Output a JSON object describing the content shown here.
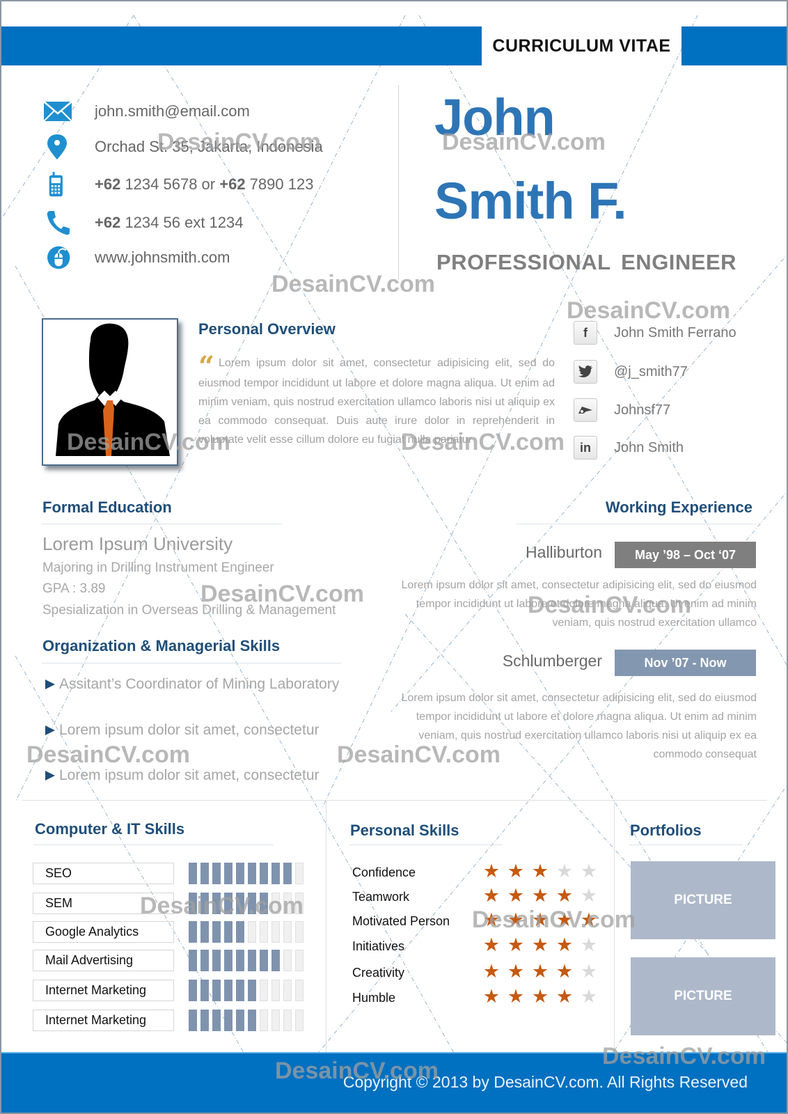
{
  "header": {
    "title": "CURRICULUM VITAE",
    "accent_color": "#0070c0"
  },
  "contact": {
    "email": "john.smith@email.com",
    "address": "Orchad St. 35, Jakarta, Indonesia",
    "mobile_prefix1": "+62",
    "mobile_number1": " 1234 5678 or ",
    "mobile_prefix2": "+62",
    "mobile_number2": " 7890 123",
    "phone_prefix": "+62",
    "phone_number": " 1234 56 ext 1234",
    "website": "www.johnsmith.com",
    "icons": [
      "envelope-icon",
      "map-pin-icon",
      "mobile-phone-icon",
      "telephone-icon",
      "globe-mouse-icon"
    ]
  },
  "profile": {
    "first_name": "John",
    "last_name": "Smith F.",
    "job_title": "PROFESSIONAL  ENGINEER",
    "name_color": "#2e75b6"
  },
  "overview": {
    "title": "Personal Overview",
    "quote_mark": "“",
    "text": "Lorem ipsum dolor sit amet, consectetur adipisicing elit, sed do eiusmod tempor incididunt ut labore et dolore magna aliqua. Ut enim ad minim veniam, quis nostrud exercitation ullamco laboris nisi ut aliquip ex ea commodo consequat. Duis aute irure dolor in reprehenderit in voluptate velit esse cillum dolore eu fugiat nulla pariatur"
  },
  "social": [
    {
      "icon": "facebook-icon",
      "glyph": "f",
      "label": "John Smith Ferrano"
    },
    {
      "icon": "twitter-icon",
      "glyph": "🐦",
      "label": "@j_smith77"
    },
    {
      "icon": "deviantart-icon",
      "glyph": "✐",
      "label": "Johnsf77"
    },
    {
      "icon": "linkedin-icon",
      "glyph": "in",
      "label": "John Smith"
    }
  ],
  "education": {
    "title": "Formal Education",
    "university": "Lorem Ipsum University",
    "items": [
      "Majoring in Drilling Instrument Engineer",
      "GPA : 3.89",
      "Spesialization in Overseas Drilling & Management"
    ]
  },
  "organization": {
    "title": "Organization & Managerial Skills",
    "items": [
      "Assitant’s Coordinator of Mining Laboratory",
      "Lorem ipsum dolor sit amet, consectetur",
      "Lorem ipsum dolor sit amet, consectetur"
    ]
  },
  "work": {
    "title": "Working Experience",
    "jobs": [
      {
        "company": "Halliburton",
        "period": "May ’98 – Oct ‘07",
        "badge_color": "#7f7f7f",
        "description": "Lorem ipsum dolor sit amet, consectetur adipisicing elit, sed do eiusmod tempor incididunt ut labore et dolore magna aliqua. Ut enim ad minim veniam, quis nostrud exercitation ullamco"
      },
      {
        "company": "Schlumberger",
        "period": "Nov ’07 - Now",
        "badge_color": "#8497b0",
        "description": "Lorem ipsum dolor sit amet, consectetur adipisicing elit, sed do eiusmod tempor incididunt ut labore et dolore magna aliqua. Ut enim ad minim veniam, quis nostrud exercitation ullamco laboris nisi ut aliquip ex ea commodo consequat"
      }
    ]
  },
  "it_skills": {
    "title": "Computer & IT Skills",
    "max": 10,
    "items": [
      {
        "label": "SEO",
        "level": 9
      },
      {
        "label": "SEM",
        "level": 7
      },
      {
        "label": "Google Analytics",
        "level": 5
      },
      {
        "label": "Mail Advertising",
        "level": 8
      },
      {
        "label": "Internet Marketing",
        "level": 6
      },
      {
        "label": "Internet Marketing",
        "level": 6
      }
    ]
  },
  "personal_skills": {
    "title": "Personal Skills",
    "max": 5,
    "items": [
      {
        "label": "Confidence",
        "stars": 3
      },
      {
        "label": "Teamwork",
        "stars": 4
      },
      {
        "label": "Motivated Person",
        "stars": 5
      },
      {
        "label": "Initiatives",
        "stars": 4
      },
      {
        "label": "Creativity",
        "stars": 4
      },
      {
        "label": "Humble",
        "stars": 4
      }
    ]
  },
  "portfolios": {
    "title": "Portfolios",
    "items": [
      "PICTURE",
      "PICTURE"
    ]
  },
  "footer": {
    "copyright": "Copyright © 2013 by DesainCV.com. All Rights Reserved"
  },
  "watermark": {
    "text": "DesainCV.com"
  }
}
